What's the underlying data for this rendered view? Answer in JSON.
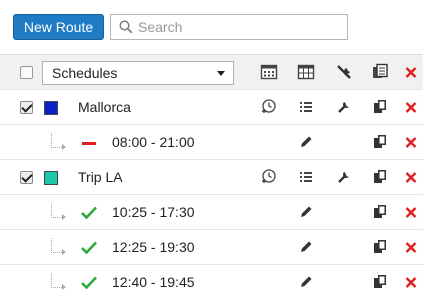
{
  "toolbar": {
    "new_route_label": "New Route",
    "search_placeholder": "Search",
    "search_value": ""
  },
  "header": {
    "select_value": "Schedules",
    "checked": false
  },
  "groups": [
    {
      "name": "Mallorca",
      "color": "#0c1fc9",
      "checked": true,
      "routes": [
        {
          "time": "08:00 - 21:00",
          "status": "inactive"
        }
      ]
    },
    {
      "name": "Trip LA",
      "color": "#1cc7aa",
      "checked": true,
      "routes": [
        {
          "time": "10:25 - 17:30",
          "status": "active"
        },
        {
          "time": "12:25 - 19:30",
          "status": "active"
        },
        {
          "time": "12:40 - 19:45",
          "status": "active"
        }
      ]
    }
  ],
  "colors": {
    "button_blue": "#1f7cc4",
    "delete_red": "#e02020",
    "active_green": "#2eaa3a",
    "inactive_red": "#e02020"
  }
}
